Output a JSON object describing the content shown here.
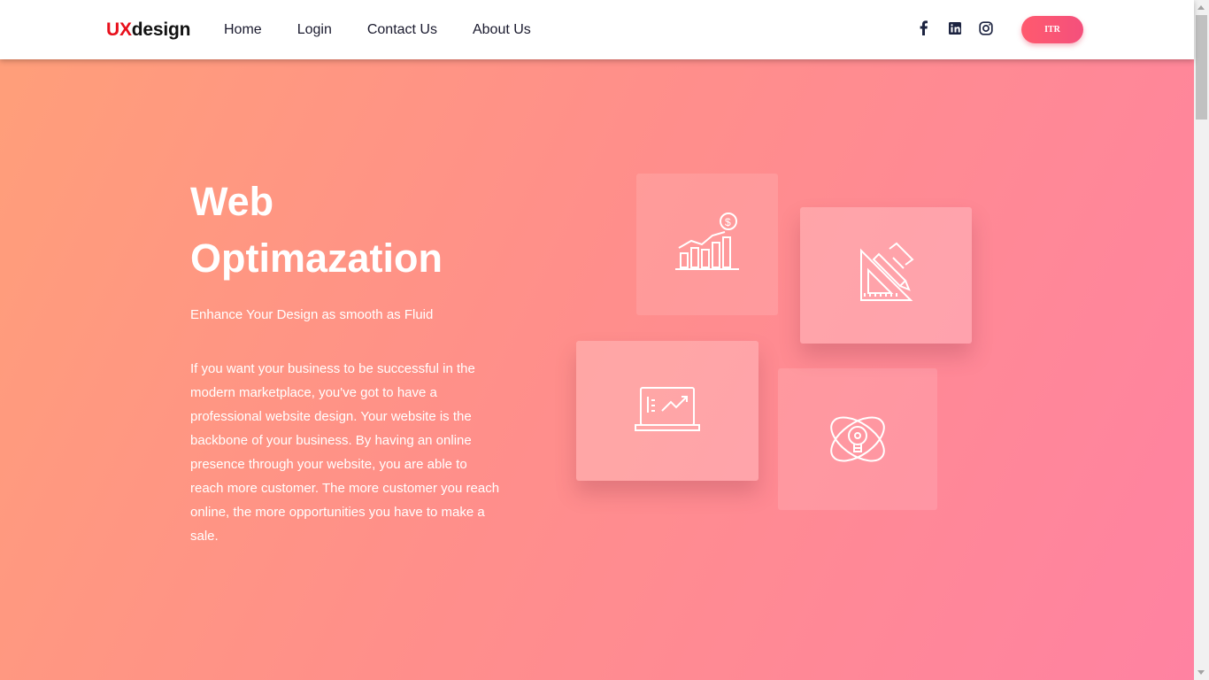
{
  "navbar": {
    "logo_prefix": "UX",
    "logo_suffix": "design",
    "links": [
      "Home",
      "Login",
      "Contact Us",
      "About Us"
    ],
    "social": [
      "facebook-icon",
      "linkedin-icon",
      "instagram-icon"
    ],
    "button_label": "ITR"
  },
  "hero": {
    "title_line1": "Web",
    "title_line2": "Optimazation",
    "subtitle": "Enhance Your Design as smooth as Fluid",
    "body": "If you want your business to be successful in the modern marketplace, you've got to have a professional website design. Your website is the backbone of your business. By having an online presence through your website, you are able to reach more customer. The more customer you reach online, the more opportunities you have to make a sale."
  },
  "cards": [
    "growth-chart-icon",
    "design-tools-icon",
    "laptop-analytics-icon",
    "idea-bulb-icon"
  ],
  "colors": {
    "accent": "#e8101c",
    "button": "#f4507c",
    "gradient_start": "#ff9f79",
    "gradient_end": "#ff82a2"
  }
}
